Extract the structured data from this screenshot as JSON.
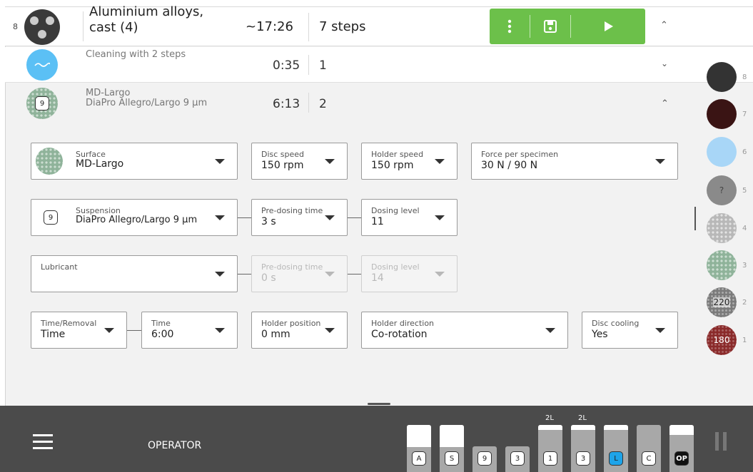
{
  "method": {
    "index": "8",
    "title_line1": "Aluminium alloys,",
    "title_line2": "cast (4)",
    "time": "~17:26",
    "steps": "7 steps"
  },
  "steps": [
    {
      "label": "Cleaning with 2 steps",
      "time": "0:35",
      "number": "1"
    },
    {
      "label_line1": "MD-Largo",
      "label_line2": "DiaPro Allegro/Largo 9 µm",
      "time": "6:13",
      "number": "2",
      "badge": "9"
    }
  ],
  "fields": {
    "surface": {
      "label": "Surface",
      "value": "MD-Largo"
    },
    "disc_speed": {
      "label": "Disc speed",
      "value": "150 rpm"
    },
    "holder_speed": {
      "label": "Holder speed",
      "value": "150 rpm"
    },
    "force": {
      "label": "Force per specimen",
      "value": "30 N / 90 N"
    },
    "suspension": {
      "label": "Suspension",
      "value": "DiaPro Allegro/Largo 9 µm",
      "badge": "9"
    },
    "predosing1": {
      "label": "Pre-dosing time",
      "value": "3 s"
    },
    "dosing1": {
      "label": "Dosing level",
      "value": "11"
    },
    "lubricant": {
      "label": "Lubricant",
      "value": ""
    },
    "predosing2": {
      "label": "Pre-dosing time",
      "value": "0 s"
    },
    "dosing2": {
      "label": "Dosing level",
      "value": "14"
    },
    "time_removal": {
      "label": "Time/Removal",
      "value": "Time"
    },
    "time": {
      "label": "Time",
      "value": "6:00"
    },
    "holder_position": {
      "label": "Holder position",
      "value": "0 mm"
    },
    "holder_direction": {
      "label": "Holder direction",
      "value": "Co-rotation"
    },
    "disc_cooling": {
      "label": "Disc cooling",
      "value": "Yes"
    }
  },
  "stack": [
    {
      "num": "8",
      "text": ""
    },
    {
      "num": "7",
      "text": ""
    },
    {
      "num": "6",
      "text": ""
    },
    {
      "num": "5",
      "text": "?"
    },
    {
      "num": "4",
      "text": ""
    },
    {
      "num": "3",
      "text": ""
    },
    {
      "num": "2",
      "text": "220"
    },
    {
      "num": "1",
      "text": "180"
    }
  ],
  "bottom": {
    "role": "OPERATOR",
    "containers": [
      {
        "label": "A",
        "top": "",
        "fill": 0.35
      },
      {
        "label": "S",
        "top": "",
        "fill": 0.35
      },
      {
        "label": "9",
        "top": "",
        "fill": 0.0
      },
      {
        "label": "3",
        "top": "",
        "fill": 0.0
      },
      {
        "label": "1",
        "top": "2L",
        "fill": 0.08
      },
      {
        "label": "3",
        "top": "2L",
        "fill": 0.08
      },
      {
        "label": "L",
        "top": "",
        "fill": 0.08
      },
      {
        "label": "C",
        "top": "",
        "fill": 0.0
      },
      {
        "label": "OP",
        "top": "",
        "fill": 0.15
      }
    ]
  },
  "colors": {
    "accent": "#6cc04a",
    "bar": "#4b4b4b",
    "cleaning": "#5bc0f5"
  }
}
